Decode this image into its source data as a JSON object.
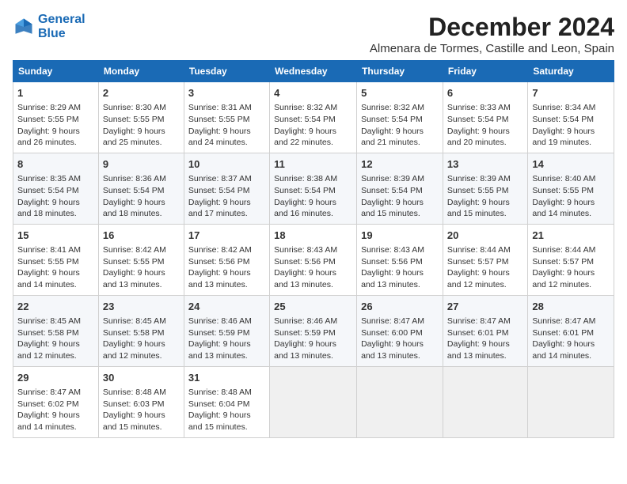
{
  "logo": {
    "line1": "General",
    "line2": "Blue"
  },
  "title": "December 2024",
  "subtitle": "Almenara de Tormes, Castille and Leon, Spain",
  "weekdays": [
    "Sunday",
    "Monday",
    "Tuesday",
    "Wednesday",
    "Thursday",
    "Friday",
    "Saturday"
  ],
  "weeks": [
    [
      {
        "day": "1",
        "info": "Sunrise: 8:29 AM\nSunset: 5:55 PM\nDaylight: 9 hours\nand 26 minutes."
      },
      {
        "day": "2",
        "info": "Sunrise: 8:30 AM\nSunset: 5:55 PM\nDaylight: 9 hours\nand 25 minutes."
      },
      {
        "day": "3",
        "info": "Sunrise: 8:31 AM\nSunset: 5:55 PM\nDaylight: 9 hours\nand 24 minutes."
      },
      {
        "day": "4",
        "info": "Sunrise: 8:32 AM\nSunset: 5:54 PM\nDaylight: 9 hours\nand 22 minutes."
      },
      {
        "day": "5",
        "info": "Sunrise: 8:32 AM\nSunset: 5:54 PM\nDaylight: 9 hours\nand 21 minutes."
      },
      {
        "day": "6",
        "info": "Sunrise: 8:33 AM\nSunset: 5:54 PM\nDaylight: 9 hours\nand 20 minutes."
      },
      {
        "day": "7",
        "info": "Sunrise: 8:34 AM\nSunset: 5:54 PM\nDaylight: 9 hours\nand 19 minutes."
      }
    ],
    [
      {
        "day": "8",
        "info": "Sunrise: 8:35 AM\nSunset: 5:54 PM\nDaylight: 9 hours\nand 18 minutes."
      },
      {
        "day": "9",
        "info": "Sunrise: 8:36 AM\nSunset: 5:54 PM\nDaylight: 9 hours\nand 18 minutes."
      },
      {
        "day": "10",
        "info": "Sunrise: 8:37 AM\nSunset: 5:54 PM\nDaylight: 9 hours\nand 17 minutes."
      },
      {
        "day": "11",
        "info": "Sunrise: 8:38 AM\nSunset: 5:54 PM\nDaylight: 9 hours\nand 16 minutes."
      },
      {
        "day": "12",
        "info": "Sunrise: 8:39 AM\nSunset: 5:54 PM\nDaylight: 9 hours\nand 15 minutes."
      },
      {
        "day": "13",
        "info": "Sunrise: 8:39 AM\nSunset: 5:55 PM\nDaylight: 9 hours\nand 15 minutes."
      },
      {
        "day": "14",
        "info": "Sunrise: 8:40 AM\nSunset: 5:55 PM\nDaylight: 9 hours\nand 14 minutes."
      }
    ],
    [
      {
        "day": "15",
        "info": "Sunrise: 8:41 AM\nSunset: 5:55 PM\nDaylight: 9 hours\nand 14 minutes."
      },
      {
        "day": "16",
        "info": "Sunrise: 8:42 AM\nSunset: 5:55 PM\nDaylight: 9 hours\nand 13 minutes."
      },
      {
        "day": "17",
        "info": "Sunrise: 8:42 AM\nSunset: 5:56 PM\nDaylight: 9 hours\nand 13 minutes."
      },
      {
        "day": "18",
        "info": "Sunrise: 8:43 AM\nSunset: 5:56 PM\nDaylight: 9 hours\nand 13 minutes."
      },
      {
        "day": "19",
        "info": "Sunrise: 8:43 AM\nSunset: 5:56 PM\nDaylight: 9 hours\nand 13 minutes."
      },
      {
        "day": "20",
        "info": "Sunrise: 8:44 AM\nSunset: 5:57 PM\nDaylight: 9 hours\nand 12 minutes."
      },
      {
        "day": "21",
        "info": "Sunrise: 8:44 AM\nSunset: 5:57 PM\nDaylight: 9 hours\nand 12 minutes."
      }
    ],
    [
      {
        "day": "22",
        "info": "Sunrise: 8:45 AM\nSunset: 5:58 PM\nDaylight: 9 hours\nand 12 minutes."
      },
      {
        "day": "23",
        "info": "Sunrise: 8:45 AM\nSunset: 5:58 PM\nDaylight: 9 hours\nand 12 minutes."
      },
      {
        "day": "24",
        "info": "Sunrise: 8:46 AM\nSunset: 5:59 PM\nDaylight: 9 hours\nand 13 minutes."
      },
      {
        "day": "25",
        "info": "Sunrise: 8:46 AM\nSunset: 5:59 PM\nDaylight: 9 hours\nand 13 minutes."
      },
      {
        "day": "26",
        "info": "Sunrise: 8:47 AM\nSunset: 6:00 PM\nDaylight: 9 hours\nand 13 minutes."
      },
      {
        "day": "27",
        "info": "Sunrise: 8:47 AM\nSunset: 6:01 PM\nDaylight: 9 hours\nand 13 minutes."
      },
      {
        "day": "28",
        "info": "Sunrise: 8:47 AM\nSunset: 6:01 PM\nDaylight: 9 hours\nand 14 minutes."
      }
    ],
    [
      {
        "day": "29",
        "info": "Sunrise: 8:47 AM\nSunset: 6:02 PM\nDaylight: 9 hours\nand 14 minutes."
      },
      {
        "day": "30",
        "info": "Sunrise: 8:48 AM\nSunset: 6:03 PM\nDaylight: 9 hours\nand 15 minutes."
      },
      {
        "day": "31",
        "info": "Sunrise: 8:48 AM\nSunset: 6:04 PM\nDaylight: 9 hours\nand 15 minutes."
      },
      null,
      null,
      null,
      null
    ]
  ]
}
